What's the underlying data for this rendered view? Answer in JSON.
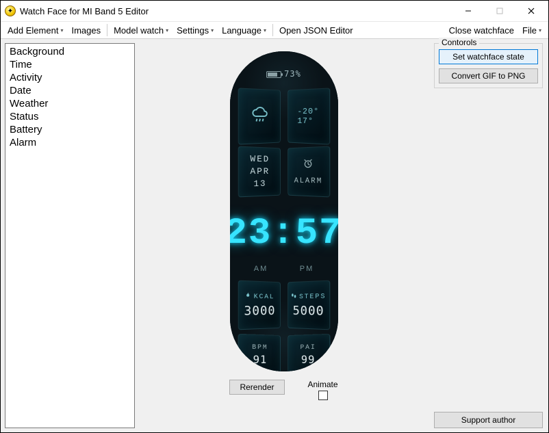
{
  "window": {
    "title": "Watch Face for MI Band 5 Editor"
  },
  "menu": {
    "add_element": "Add Element",
    "images": "Images",
    "model_watch": "Model watch",
    "settings": "Settings",
    "language": "Language",
    "open_json": "Open JSON Editor",
    "close_watchface": "Close watchface",
    "file": "File"
  },
  "sidebar": {
    "items": [
      "Background",
      "Time",
      "Activity",
      "Date",
      "Weather",
      "Status",
      "Battery",
      "Alarm"
    ]
  },
  "watch": {
    "battery_pct": "73%",
    "temp_low": "-20°",
    "temp_high": "17°",
    "weekday": "WED",
    "month": "APR",
    "day": "13",
    "alarm_label": "ALARM",
    "time": "23:57",
    "am": "AM",
    "pm": "PM",
    "kcal_label": "KCAL",
    "kcal_val": "3000",
    "steps_label": "STEPS",
    "steps_val": "5000",
    "bpm_label": "BPM",
    "bpm_val": "91",
    "pai_label": "PAI",
    "pai_val": "99"
  },
  "controls": {
    "rerender": "Rerender",
    "animate": "Animate",
    "group_label": "Contorols",
    "set_state": "Set watchface state",
    "convert": "Convert GIF to PNG",
    "support": "Support author"
  }
}
